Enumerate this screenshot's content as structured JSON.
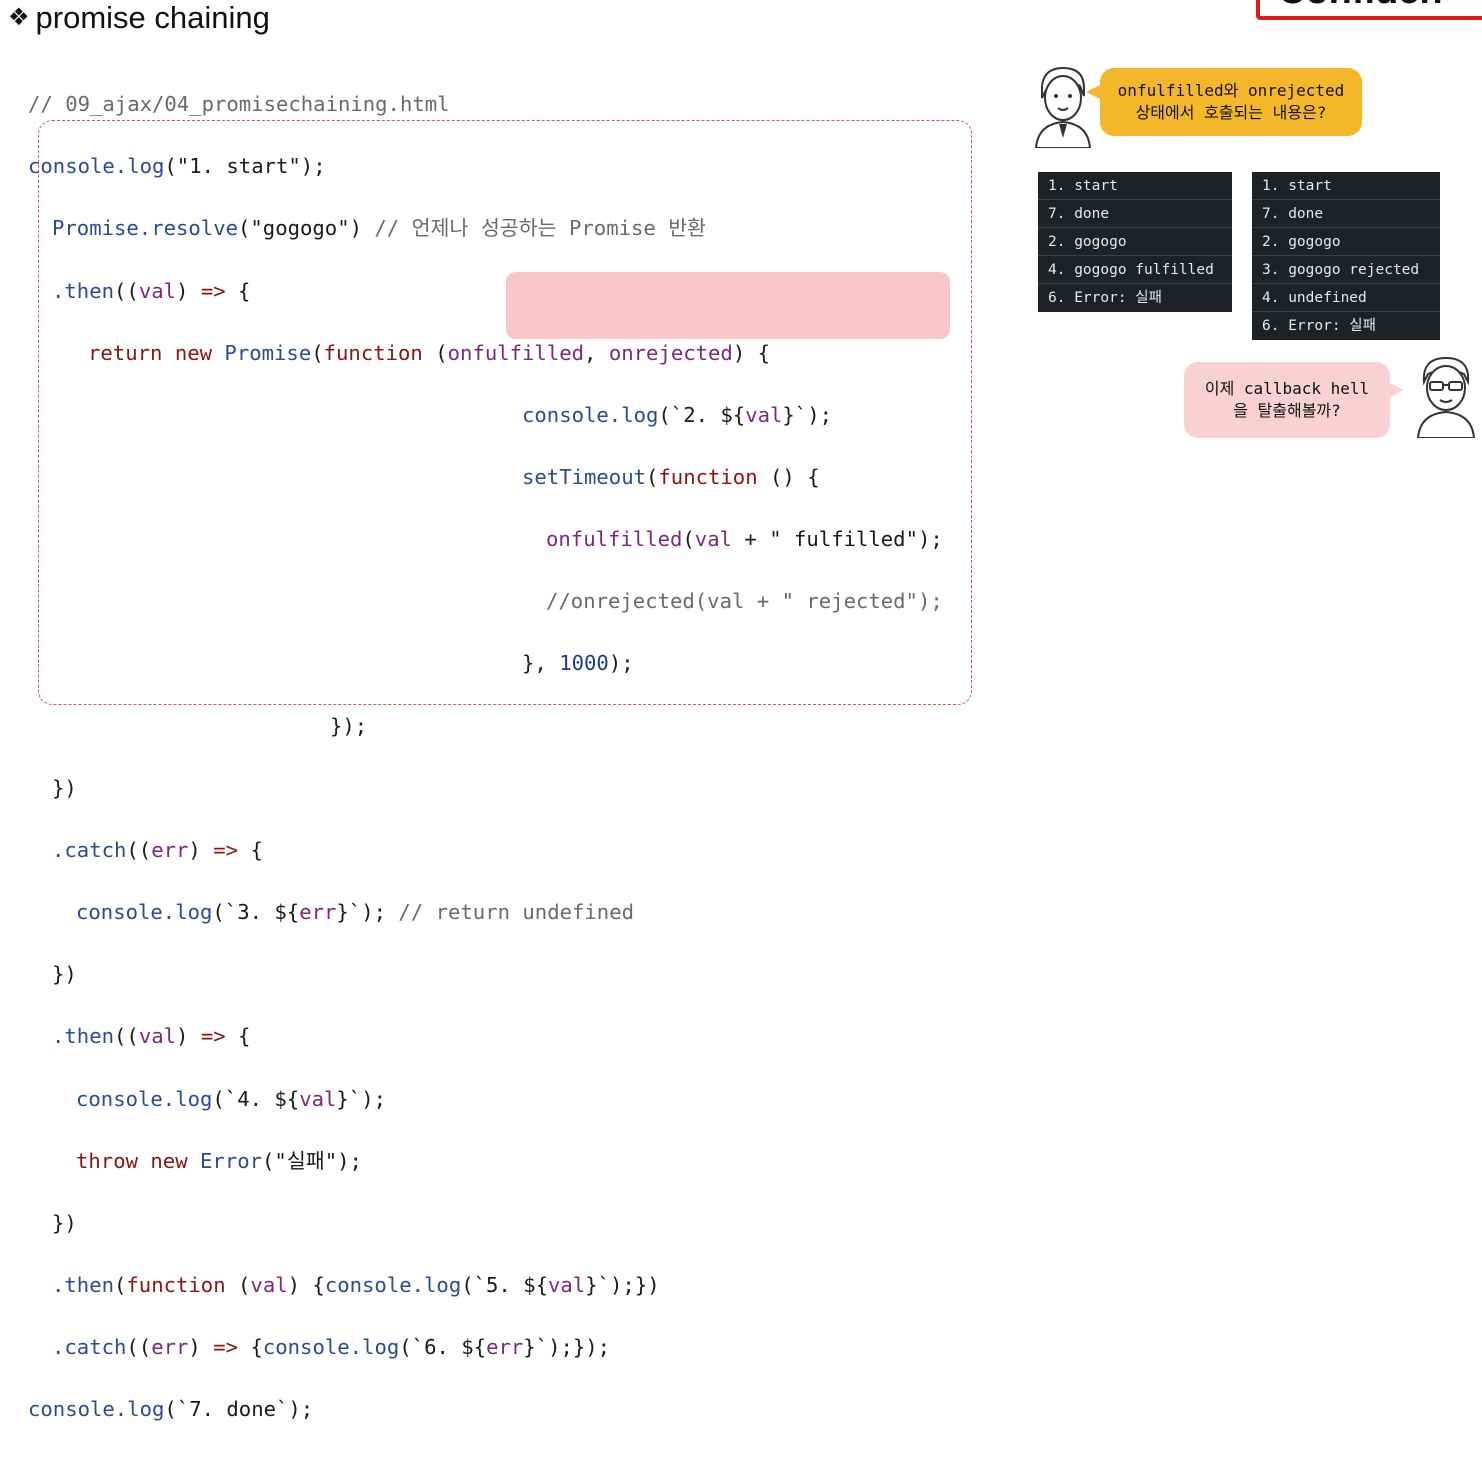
{
  "title": "promise chaining",
  "bullet": "❖",
  "stamp": "Confiden",
  "code": {
    "l1_comment": "// 09_ajax/04_promisechaining.html",
    "l2_a": "console",
    "l2_b": ".log",
    "l2_c": "(\"1. start\");",
    "l3_a": "Promise",
    "l3_b": ".resolve",
    "l3_c": "(\"gogogo\")",
    "l3_d": " // 언제나 성공하는 Promise 반환",
    "l4_a": ".then",
    "l4_b": "((",
    "l4_c": "val",
    "l4_d": ") ",
    "l4_e": "=>",
    "l4_f": " {",
    "l5_a": "return",
    "l5_b": "new",
    "l5_c": "Promise",
    "l5_d": "(",
    "l5_e": "function",
    "l5_f": " (",
    "l5_g": "onfulfilled",
    "l5_h": ", ",
    "l5_i": "onrejected",
    "l5_j": ") {",
    "l6_a": "console",
    "l6_b": ".log",
    "l6_c": "(`2. ${",
    "l6_d": "val",
    "l6_e": "}`);",
    "l7_a": "setTimeout",
    "l7_b": "(",
    "l7_c": "function",
    "l7_d": " () {",
    "l8_a": "onfulfilled",
    "l8_b": "(",
    "l8_c": "val",
    "l8_d": " + \" fulfilled\");",
    "l9_comment": "//onrejected(val + \" rejected\");",
    "l10_a": "}, ",
    "l10_b": "1000",
    "l10_c": ");",
    "l11": "});",
    "l12": "})",
    "l13_a": ".catch",
    "l13_b": "((",
    "l13_c": "err",
    "l13_d": ") ",
    "l13_e": "=>",
    "l13_f": " {",
    "l14_a": "console",
    "l14_b": ".log",
    "l14_c": "(`3. ${",
    "l14_d": "err",
    "l14_e": "}`);",
    "l14_f": " // return undefined",
    "l15": "})",
    "l16_a": ".then",
    "l16_b": "((",
    "l16_c": "val",
    "l16_d": ") ",
    "l16_e": "=>",
    "l16_f": " {",
    "l17_a": "console",
    "l17_b": ".log",
    "l17_c": "(`4. ${",
    "l17_d": "val",
    "l17_e": "}`);",
    "l18_a": "throw",
    "l18_b": "new",
    "l18_c": "Error",
    "l18_d": "(\"실패\");",
    "l19": "})",
    "l20_a": ".then",
    "l20_b": "(",
    "l20_c": "function",
    "l20_d": " (",
    "l20_e": "val",
    "l20_f": ") {",
    "l20_g": "console",
    "l20_h": ".log",
    "l20_i": "(`5. ${",
    "l20_j": "val",
    "l20_k": "}`);})",
    "l21_a": ".catch",
    "l21_b": "((",
    "l21_c": "err",
    "l21_d": ") ",
    "l21_e": "=>",
    "l21_f": " {",
    "l21_g": "console",
    "l21_h": ".log",
    "l21_i": "(`6. ${",
    "l21_j": "err",
    "l21_k": "}`);});",
    "l22_a": "console",
    "l22_b": ".log",
    "l22_c": "(`7. done`);"
  },
  "bubble_question": {
    "line1": "onfulfilled와 onrejected",
    "line2": "상태에서 호출되는 내용은?"
  },
  "bubble_next": {
    "line1": "이제 callback hell",
    "line2": "을 탈출해볼까?"
  },
  "terminal_fulfilled": [
    "1. start",
    "7. done",
    "2. gogogo",
    "4. gogogo fulfilled",
    "6. Error: 실패"
  ],
  "terminal_rejected": [
    "1. start",
    "7. done",
    "2. gogogo",
    "3. gogogo rejected",
    "4. undefined",
    "6. Error: 실패"
  ]
}
